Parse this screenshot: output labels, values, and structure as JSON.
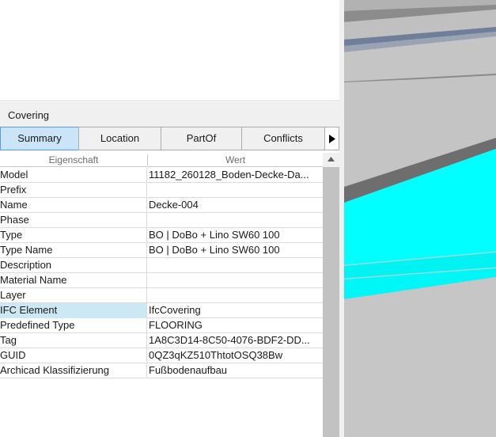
{
  "panel": {
    "title": "Covering",
    "tabs": [
      {
        "label": "Summary",
        "active": true
      },
      {
        "label": "Location",
        "active": false
      },
      {
        "label": "PartOf",
        "active": false
      },
      {
        "label": "Conflicts",
        "active": false
      }
    ],
    "tab_more_icon": "chevron-right-icon"
  },
  "grid": {
    "columns": {
      "property": "Eigenschaft",
      "value": "Wert"
    },
    "rows": [
      {
        "name": "Model",
        "value": "11182_260128_Boden-Decke-Da..."
      },
      {
        "name": "Prefix",
        "value": ""
      },
      {
        "name": "Name",
        "value": "Decke-004"
      },
      {
        "name": "Phase",
        "value": ""
      },
      {
        "name": "Type",
        "value": "BO | DoBo + Lino SW60 100"
      },
      {
        "name": "Type Name",
        "value": "BO | DoBo + Lino SW60 100"
      },
      {
        "name": "Description",
        "value": ""
      },
      {
        "name": "Material Name",
        "value": ""
      },
      {
        "name": "Layer",
        "value": ""
      },
      {
        "name": "IFC Element",
        "value": "IfcCovering",
        "selected": true
      },
      {
        "name": "Predefined Type",
        "value": "FLOORING"
      },
      {
        "name": "Tag",
        "value": "1A8C3D14-8C50-4076-BDF2-DD..."
      },
      {
        "name": "GUID",
        "value": "0QZ3qKZ510ThtotOSQ38Bw"
      },
      {
        "name": "Archicad Klassifizierung",
        "value": "Fußbodenaufbau"
      }
    ]
  },
  "colors": {
    "tab_active_bg": "#cce4f7",
    "tab_active_border": "#569de5",
    "selected_row": "#cce8f4",
    "highlight_cyan": "#00ffff"
  }
}
